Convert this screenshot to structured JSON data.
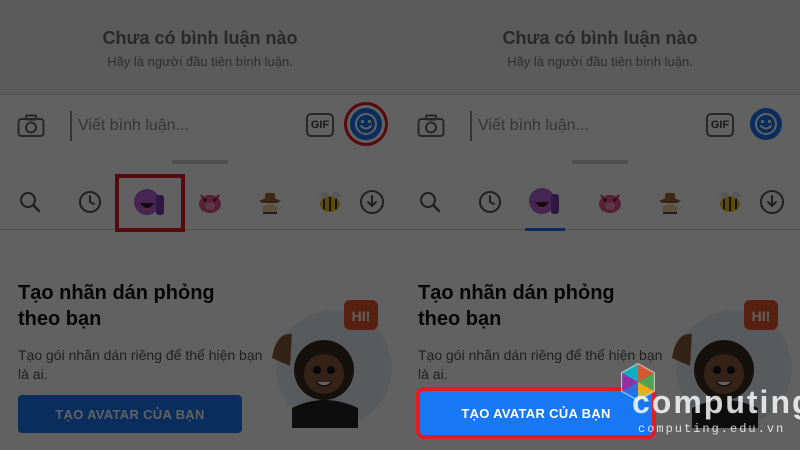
{
  "panels": [
    {
      "no_comments_title": "Chưa có bình luận nào",
      "no_comments_subtitle": "Hãy là người đầu tiên bình luận.",
      "comment_placeholder": "Viết bình luận...",
      "gif_label": "GIF",
      "sticker_heading": "Tạo nhãn dán phỏng theo bạn",
      "sticker_desc": "Tạo gói nhãn dán riêng để thể hiện bạn là ai.",
      "cta_label": "TẠO AVATAR CỦA BẠN",
      "avatar_bubble": "HI!"
    },
    {
      "no_comments_title": "Chưa có bình luận nào",
      "no_comments_subtitle": "Hãy là người đầu tiên bình luận.",
      "comment_placeholder": "Viết bình luận...",
      "gif_label": "GIF",
      "sticker_heading": "Tạo nhãn dán phỏng theo bạn",
      "sticker_desc": "Tạo gói nhãn dán riêng để thể hiện bạn là ai.",
      "cta_label": "TẠO AVATAR CỦA BẠN",
      "avatar_bubble": "HI!"
    }
  ],
  "tabs": [
    "search-icon",
    "recent-icon",
    "avatar-sticker-icon",
    "pig-sticker-icon",
    "cowboy-sticker-icon",
    "bee-sticker-icon",
    "download-icon"
  ],
  "watermark": {
    "brand": "computing",
    "domain": "computing.edu.vn"
  },
  "colors": {
    "brand_blue": "#1877f2",
    "highlight_red": "#e31b23",
    "avatar_purple": "#9c4dcc"
  }
}
